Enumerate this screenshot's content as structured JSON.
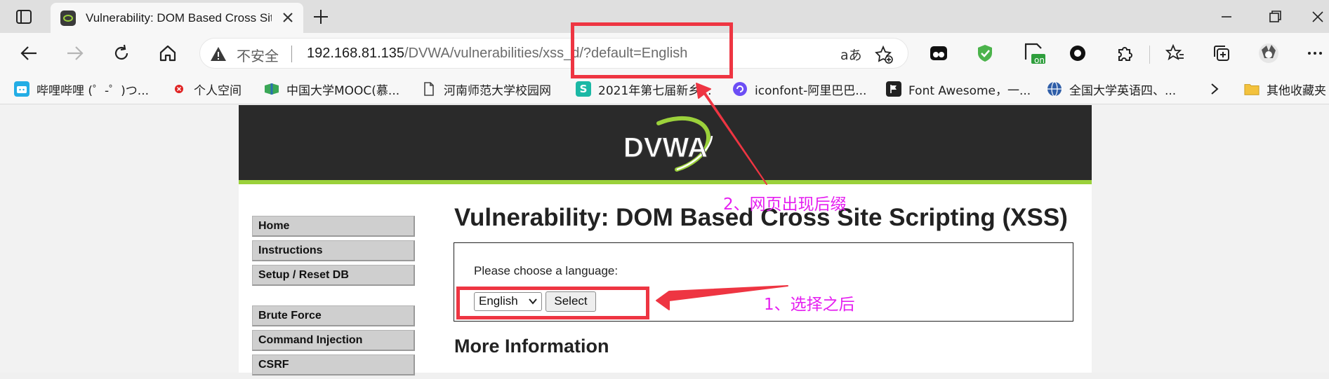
{
  "browser": {
    "tab": {
      "title": "Vulnerability: DOM Based Cross Site Scripting (XSS)"
    },
    "address_bar": {
      "security_label": "不安全",
      "url_host": "192.168.81.135",
      "url_path": "/DVWA/vulnerabilities/xss_d/?default=English",
      "read_aloud_label": "aあ"
    },
    "extension_badge": "on",
    "bookmarks": [
      {
        "label": "哔哩哔哩 (゜-゜)つ...",
        "icon": "bilibili-icon",
        "color": "#23ade5"
      },
      {
        "label": "个人空间",
        "icon": "red-dot-icon",
        "color": "#e02424"
      },
      {
        "label": "中国大学MOOC(慕...",
        "icon": "mooc-icon",
        "color": "#3aa757"
      },
      {
        "label": "河南师范大学校园网",
        "icon": "page-icon",
        "color": "#444444"
      },
      {
        "label": "2021年第七届新乡...",
        "icon": "s-icon",
        "color": "#1bb8a5"
      },
      {
        "label": "iconfont-阿里巴巴...",
        "icon": "iconfont-icon",
        "color": "#6c4ef5"
      },
      {
        "label": "Font Awesome，一...",
        "icon": "flag-icon",
        "color": "#222222"
      },
      {
        "label": "全国大学英语四、...",
        "icon": "globe-icon",
        "color": "#2f5ea8"
      }
    ],
    "other_bookmarks": "其他收藏夹"
  },
  "page": {
    "logo_text": "DVWA",
    "nav": [
      [
        "Home",
        "Instructions",
        "Setup / Reset DB"
      ],
      [
        "Brute Force",
        "Command Injection",
        "CSRF"
      ]
    ],
    "title": "Vulnerability: DOM Based Cross Site Scripting (XSS)",
    "form": {
      "label": "Please choose a language:",
      "selected_language": "English",
      "button_label": "Select"
    },
    "more_info_heading": "More Information"
  },
  "annotations": {
    "step1": "1、选择之后",
    "step2": "2、网页出现后缀",
    "color": "#e51ef0",
    "box_color": "#ee3542"
  }
}
